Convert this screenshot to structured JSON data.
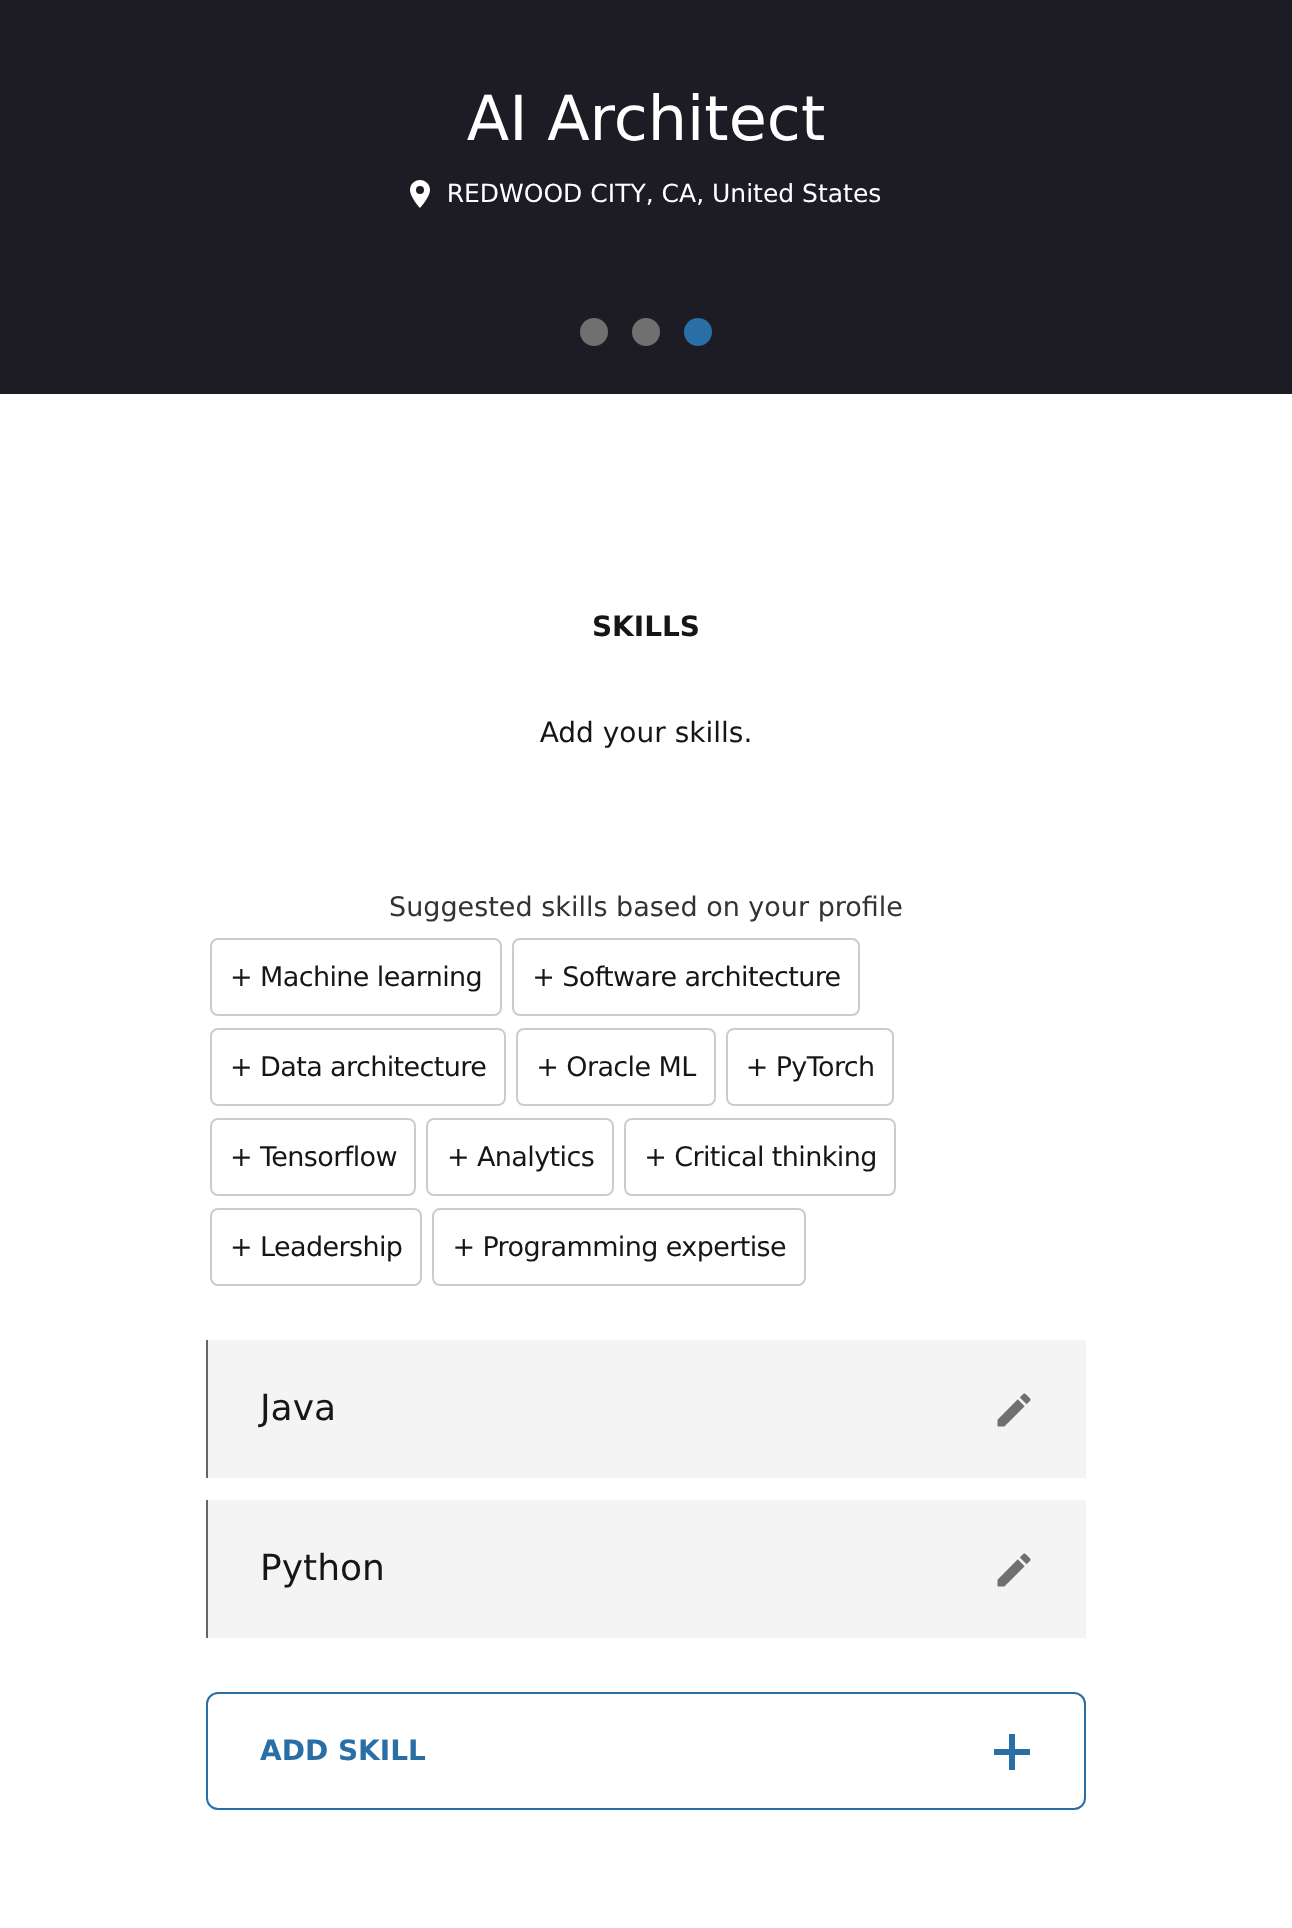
{
  "header": {
    "title": "AI Architect",
    "location": "REDWOOD CITY, CA, United States",
    "dots": [
      {
        "selected": false
      },
      {
        "selected": false
      },
      {
        "selected": true
      }
    ]
  },
  "section": {
    "heading": "SKILLS",
    "subtitle": "Add your skills.",
    "suggestions_label": "Suggested skills based on your profile"
  },
  "suggestions": [
    {
      "label": "+ Machine learning"
    },
    {
      "label": "+ Software architecture"
    },
    {
      "label": "+ Data architecture"
    },
    {
      "label": "+ Oracle ML"
    },
    {
      "label": "+ PyTorch"
    },
    {
      "label": "+ Tensorflow"
    },
    {
      "label": "+ Analytics"
    },
    {
      "label": "+ Critical thinking"
    },
    {
      "label": "+ Leadership"
    },
    {
      "label": "+ Programming expertise"
    }
  ],
  "skills": [
    {
      "name": "Java"
    },
    {
      "name": "Python"
    }
  ],
  "add_button": {
    "label": "ADD SKILL"
  }
}
